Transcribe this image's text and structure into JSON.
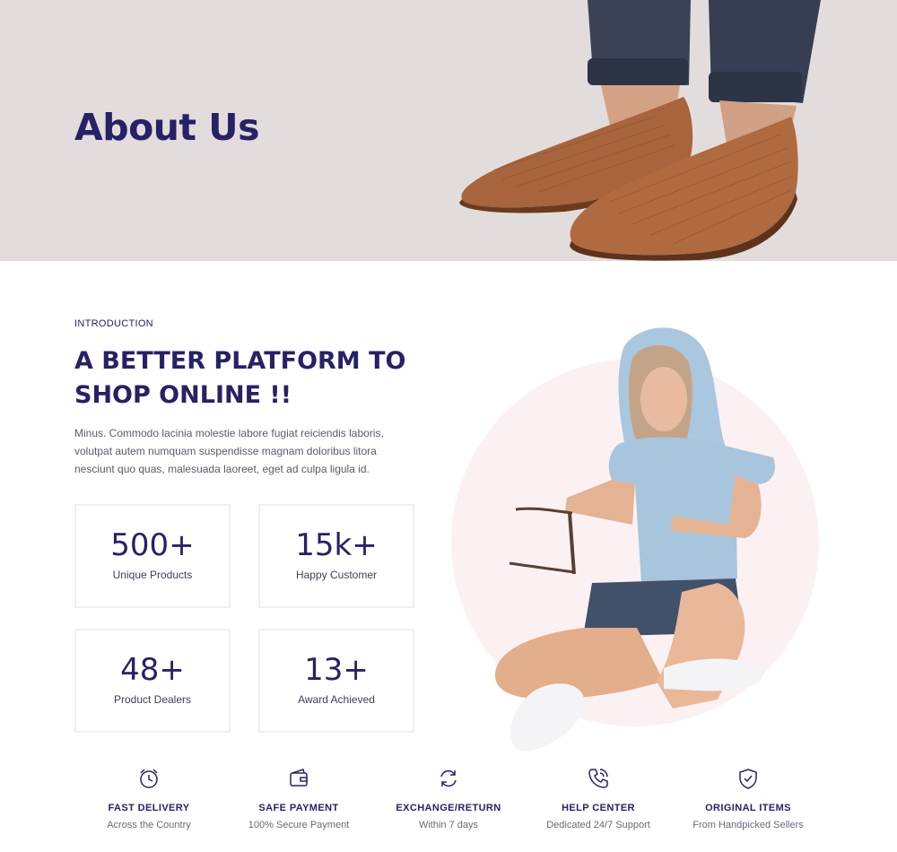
{
  "hero": {
    "title": "About Us"
  },
  "intro": {
    "eyebrow": "INTRODUCTION",
    "headline": "A BETTER PLATFORM TO SHOP ONLINE !!",
    "text": "Minus. Commodo lacinia molestie labore fugiat reiciendis laboris, volutpat autem numquam suspendisse magnam doloribus litora nesciunt quo quas, malesuada laoreet, eget ad culpa ligula id."
  },
  "stats": [
    {
      "value": "500+",
      "label": "Unique Products"
    },
    {
      "value": "15k+",
      "label": "Happy Customer"
    },
    {
      "value": "48+",
      "label": "Product Dealers"
    },
    {
      "value": "13+",
      "label": "Award Achieved"
    }
  ],
  "features": [
    {
      "icon": "alarm-clock-icon",
      "title": "FAST DELIVERY",
      "subtitle": "Across the Country"
    },
    {
      "icon": "wallet-icon",
      "title": "SAFE PAYMENT",
      "subtitle": "100% Secure Payment"
    },
    {
      "icon": "refresh-icon",
      "title": "EXCHANGE/RETURN",
      "subtitle": "Within 7 days"
    },
    {
      "icon": "phone-icon",
      "title": "HELP CENTER",
      "subtitle": "Dedicated 24/7 Support"
    },
    {
      "icon": "shield-check-icon",
      "title": "ORIGINAL ITEMS",
      "subtitle": "From Handpicked Sellers"
    }
  ],
  "colors": {
    "primary": "#262265",
    "hero_bg": "#e3dcdc",
    "circle_bg": "#fcf1f2",
    "text_muted": "#5b5b6b"
  }
}
